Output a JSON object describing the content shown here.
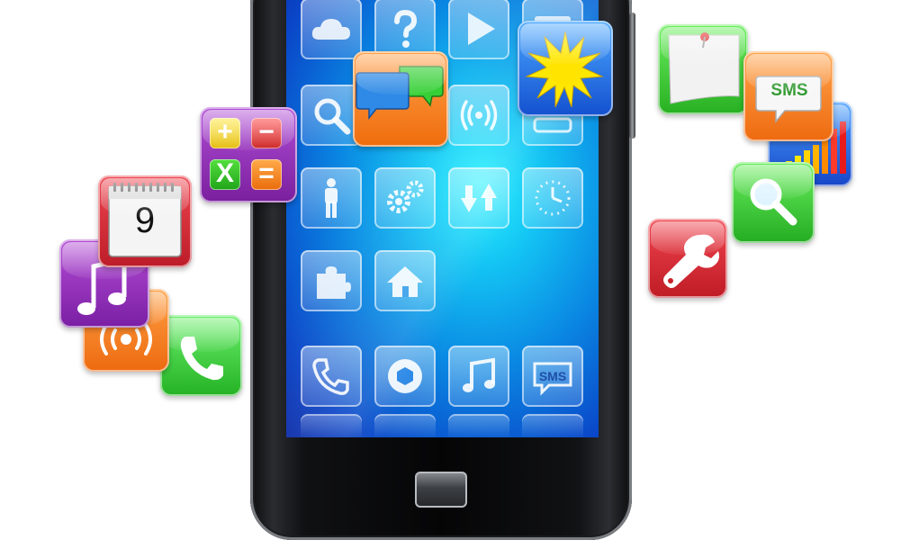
{
  "screen_apps": [
    {
      "name": "weather-cloud"
    },
    {
      "name": "help"
    },
    {
      "name": "play"
    },
    {
      "name": "mail"
    },
    {
      "name": "search"
    },
    {
      "name": "chat"
    },
    {
      "name": "wifi-signal"
    },
    {
      "name": "messages"
    },
    {
      "name": "person"
    },
    {
      "name": "settings"
    },
    {
      "name": "sync-arrows"
    },
    {
      "name": "clock"
    },
    {
      "name": "puzzle"
    },
    {
      "name": "home"
    },
    {
      "name": "phone"
    },
    {
      "name": "camera-aperture"
    },
    {
      "name": "music"
    },
    {
      "name": "sms"
    }
  ],
  "labels": {
    "sms_tile": "SMS",
    "sms_app": "SMS",
    "calendar_day": "9",
    "calc_plus": "+",
    "calc_minus": "−",
    "calc_times": "X",
    "calc_equals": "="
  },
  "colors": {
    "screen_top": "#0b2aa8",
    "screen_glow": "#2ef2ff",
    "phone_body": "#0b0b0c",
    "sun_app": "#1e6fe0",
    "chat_app": "#f07a14",
    "calc_app": "#8e2fb3",
    "calendar_app": "#d42e3a",
    "music_app": "#8a2db8",
    "radio_app": "#f07a14",
    "phone_app": "#3ccf3c",
    "notes_app": "#48cc48",
    "sms_app": "#f27a18",
    "chart_app": "#1f63d9",
    "search_app": "#34c234",
    "tools_app": "#d5262f"
  }
}
